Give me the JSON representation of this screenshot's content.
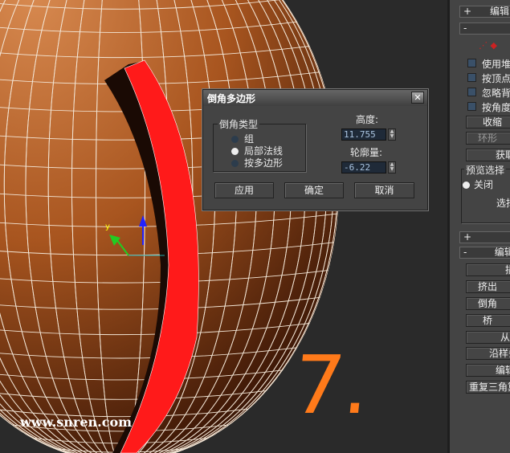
{
  "viewport": {
    "watermark": "www.snren.com",
    "annotation": "7.",
    "gizmo_axis_label": "y"
  },
  "dialog": {
    "title": "倒角多边形",
    "close_icon": "close-icon",
    "bevel_type": {
      "label": "倒角类型",
      "options": [
        "组",
        "局部法线",
        "按多边形"
      ],
      "selected": "局部法线"
    },
    "height": {
      "label": "高度:",
      "value": "11.755"
    },
    "outline": {
      "label": "轮廓量:",
      "value": "-6.22"
    },
    "buttons": {
      "apply": "应用",
      "ok": "确定",
      "cancel": "取消"
    }
  },
  "panel": {
    "rollout1": {
      "toggle": "+",
      "title": "编辑"
    },
    "rollout2": {
      "toggle": "-"
    },
    "checkboxes": [
      "使用堆栈",
      "按顶点",
      "忽略背面",
      "按角度"
    ],
    "buttons1": [
      "收缩",
      "环形",
      "获取"
    ],
    "preview": {
      "label": "预览选择",
      "option": "关闭",
      "select": "选择"
    },
    "rollout3": {
      "toggle": "+"
    },
    "rollout4": {
      "toggle": "-",
      "title": "编辑"
    },
    "buttons2": [
      "插",
      "挤出",
      "倒角",
      "桥",
      "从边",
      "沿样条",
      "编辑",
      "重复三角算法"
    ]
  },
  "colors": {
    "sphere": "#b8642a",
    "selection": "#ff1a1a",
    "annotation": "#ff7a1a"
  }
}
